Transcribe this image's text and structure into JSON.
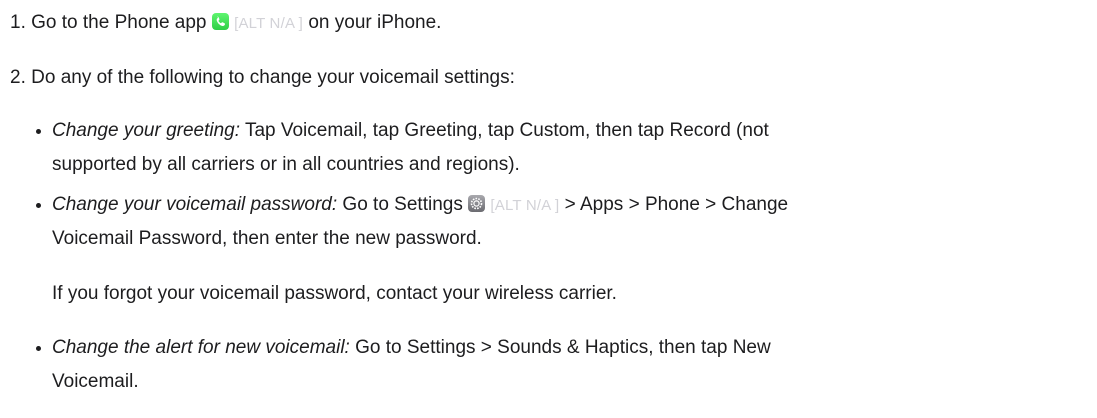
{
  "steps": [
    {
      "number": "1.",
      "text_before": "Go to the Phone app",
      "alt": "[ALT N/A ]",
      "text_after": "on your iPhone.",
      "icon": "phone-app-icon"
    },
    {
      "number": "2.",
      "text": "Do any of the following to change your voicemail settings:"
    }
  ],
  "bullets": [
    {
      "title": "Change your greeting:",
      "line1": "Tap Voicemail, tap Greeting, tap Custom, then tap Record (not",
      "line2": "supported by all carriers or in all countries and regions)."
    },
    {
      "title": "Change your voicemail password:",
      "line1_before": "Go to Settings",
      "alt": "[ALT N/A ]",
      "line1_after": "> Apps > Phone > Change",
      "line2": "Voicemail Password, then enter the new password.",
      "note": "If you forgot your voicemail password, contact your wireless carrier.",
      "icon": "settings-app-icon"
    },
    {
      "title": "Change the alert for new voicemail:",
      "line1": "Go to Settings > Sounds & Haptics, then tap New",
      "line2": "Voicemail."
    }
  ]
}
